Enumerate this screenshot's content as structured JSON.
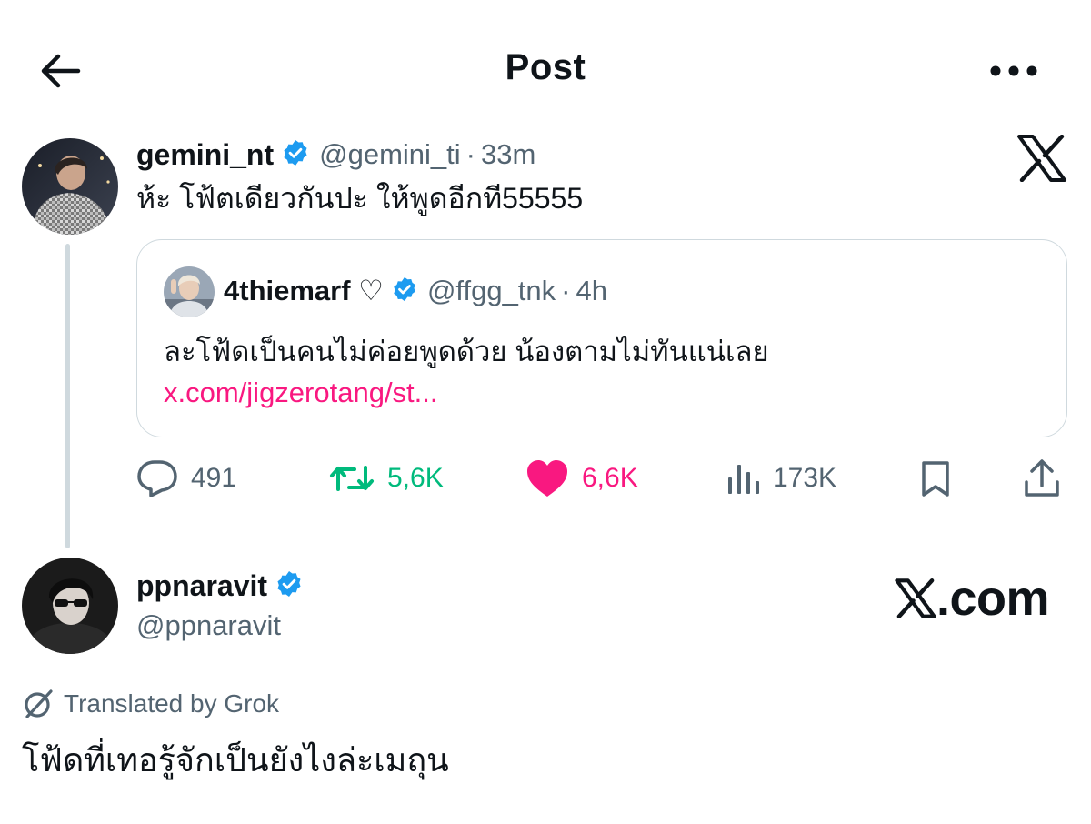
{
  "header": {
    "title": "Post"
  },
  "tweet": {
    "author_name": "gemini_nt",
    "author_handle": "@gemini_ti",
    "separator": "·",
    "time": "33m",
    "text": "ห้ะ โฟ้ตเดียวกันปะ ให้พูดอีกที55555",
    "quote": {
      "author_name": "4thiemarf ♡",
      "author_handle": "@ffgg_tnk",
      "separator": "·",
      "time": "4h",
      "text": "ละโฟ้ดเป็นคนไม่ค่อยพูดด้วย น้องตามไม่ทันแน่เลย ",
      "link": "x.com/jigzerotang/st..."
    },
    "actions": {
      "replies": "491",
      "reposts": "5,6K",
      "likes": "6,6K",
      "views": "173K"
    }
  },
  "reply": {
    "author_name": "ppnaravit",
    "author_handle": "@ppnaravit",
    "translated_label": "Translated by Grok",
    "text": "โฟ้ดที่เทอรู้จักเป็นยังไงล่ะเมถุน"
  },
  "brand": {
    "site": ".com"
  },
  "colors": {
    "text": "#0f1419",
    "secondary": "#536471",
    "verified": "#1d9bf0",
    "link": "#f91880",
    "repost": "#00ba7c",
    "like": "#f91880",
    "border": "#cfd9de"
  },
  "icons": [
    "back-arrow-icon",
    "more-icon",
    "verified-badge-icon",
    "x-logo-icon",
    "reply-icon",
    "repost-icon",
    "heart-icon",
    "views-icon",
    "bookmark-icon",
    "share-icon",
    "grok-icon"
  ]
}
